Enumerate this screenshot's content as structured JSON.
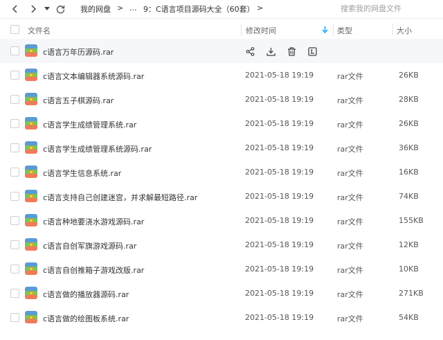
{
  "breadcrumb": {
    "root": "我的网盘",
    "sep1": ">",
    "ellipsis": "...",
    "current": "9：C语言项目源码大全（60套）",
    "sep3": ">"
  },
  "search": {
    "placeholder": "搜索我的网盘文件"
  },
  "columns": {
    "name": "文件名",
    "modified": "修改时间",
    "type": "类型",
    "size": "大小"
  },
  "icons": {
    "back": "chevron-left-icon",
    "forward": "chevron-right-icon",
    "history": "caret-down-icon",
    "refresh": "refresh-icon",
    "sort": "sort-down-icon",
    "file": "rar-archive-icon",
    "share": "share-icon",
    "download": "download-icon",
    "delete": "trash-icon",
    "more": "rename-icon"
  },
  "colors": {
    "accent": "#06a7ff"
  },
  "files": [
    {
      "name": "c语言万年历源码.rar",
      "date": "",
      "type": "",
      "size": ""
    },
    {
      "name": "c语言文本编辑器系统源码.rar",
      "date": "2021-05-18 19:19",
      "type": "rar文件",
      "size": "26KB"
    },
    {
      "name": "c语言五子棋源码.rar",
      "date": "2021-05-18 19:19",
      "type": "rar文件",
      "size": "28KB"
    },
    {
      "name": "c语言学生成绩管理系统.rar",
      "date": "2021-05-18 19:19",
      "type": "rar文件",
      "size": "26KB"
    },
    {
      "name": "c语言学生成绩管理系统源码.rar",
      "date": "2021-05-18 19:19",
      "type": "rar文件",
      "size": "36KB"
    },
    {
      "name": "c语言学生信息系统.rar",
      "date": "2021-05-18 19:19",
      "type": "rar文件",
      "size": "16KB"
    },
    {
      "name": "c语言支持自己创建迷宫，并求解最短路径.rar",
      "date": "2021-05-18 19:19",
      "type": "rar文件",
      "size": "74KB"
    },
    {
      "name": "c语言种地要浇水游戏源码.rar",
      "date": "2021-05-18 19:19",
      "type": "rar文件",
      "size": "155KB"
    },
    {
      "name": "c语言自创军旗游戏源码.rar",
      "date": "2021-05-18 19:19",
      "type": "rar文件",
      "size": "12KB"
    },
    {
      "name": "c语言自创推箱子游戏改版.rar",
      "date": "2021-05-18 19:19",
      "type": "rar文件",
      "size": "10KB"
    },
    {
      "name": "c语言做的播放器源码.rar",
      "date": "2021-05-18 19:19",
      "type": "rar文件",
      "size": "271KB"
    },
    {
      "name": "c语言做的绘图板系统.rar",
      "date": "2021-05-18 19:19",
      "type": "rar文件",
      "size": "54KB"
    }
  ]
}
